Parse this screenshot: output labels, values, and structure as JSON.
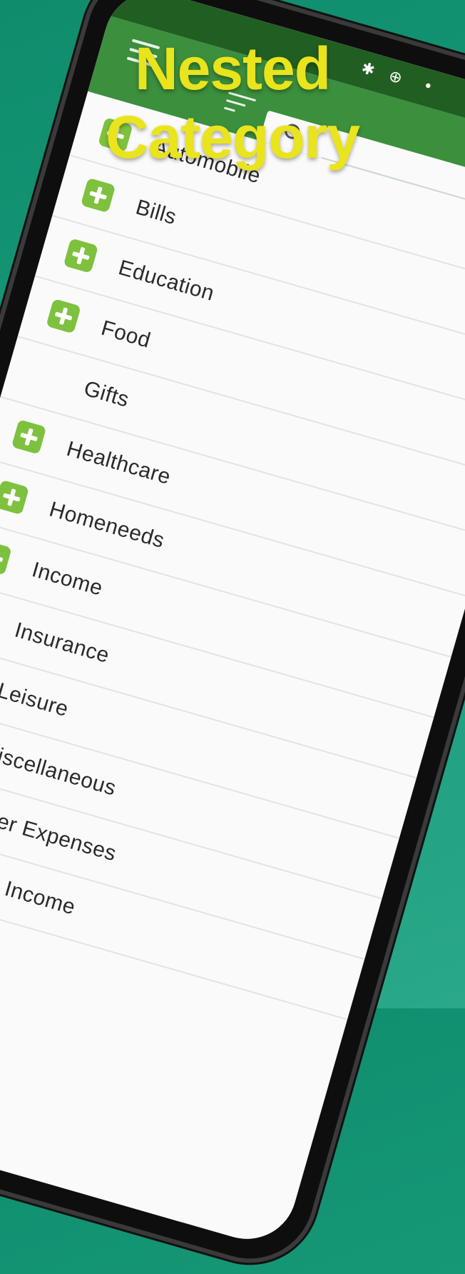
{
  "headline": {
    "line1": "Nested",
    "line2": "Category"
  },
  "colors": {
    "background": "#179a78",
    "headline": "#e9e41c",
    "status_bar": "#215e22",
    "app_bar": "#3b8f3d",
    "expand_icon": "#7ec13f",
    "list_bg": "#fafafa"
  },
  "status_icons": [
    "bluetooth-icon",
    "data-saver-icon",
    "dot-icon"
  ],
  "categories": [
    {
      "label": "Automobile",
      "expandable": true
    },
    {
      "label": "Bills",
      "expandable": true
    },
    {
      "label": "Education",
      "expandable": true
    },
    {
      "label": "Food",
      "expandable": true
    },
    {
      "label": "Gifts",
      "expandable": false
    },
    {
      "label": "Healthcare",
      "expandable": true
    },
    {
      "label": "Homeneeds",
      "expandable": true
    },
    {
      "label": "Income",
      "expandable": true
    },
    {
      "label": "Insurance",
      "expandable": true
    },
    {
      "label": "Leisure",
      "expandable": true
    },
    {
      "label": "Miscellaneous",
      "expandable": false
    },
    {
      "label": "Other Expenses",
      "expandable": false
    },
    {
      "label": "Other Income",
      "expandable": false
    }
  ]
}
